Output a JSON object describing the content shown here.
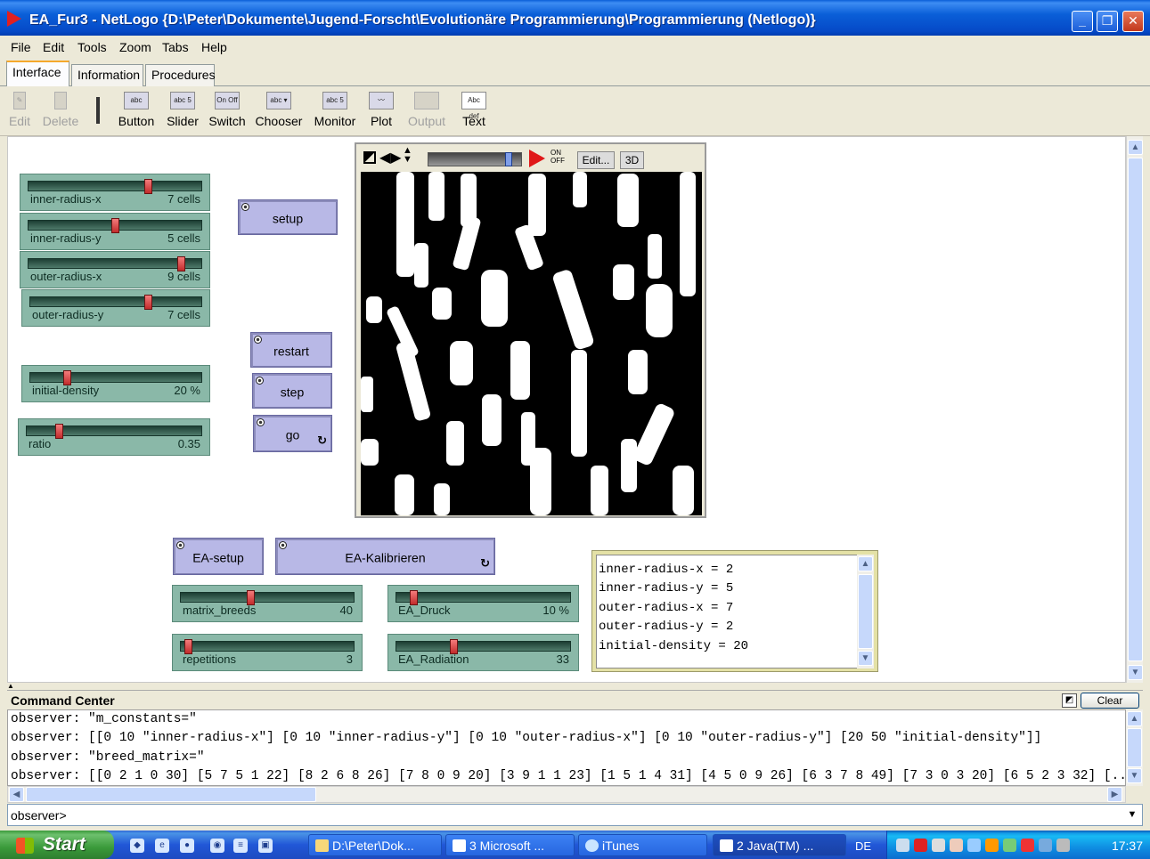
{
  "window": {
    "title": "EA_Fur3 - NetLogo {D:\\Peter\\Dokumente\\Jugend-Forscht\\Evolutionäre Programmierung\\Programmierung (Netlogo)}",
    "min_label": "_",
    "max_label": "❐",
    "close_label": "✕"
  },
  "menu": [
    "File",
    "Edit",
    "Tools",
    "Zoom",
    "Tabs",
    "Help"
  ],
  "tabs": [
    "Interface",
    "Information",
    "Procedures"
  ],
  "toolbar": {
    "tools": [
      "Edit",
      "Delete",
      "Button",
      "Slider",
      "Switch",
      "Chooser",
      "Monitor",
      "Plot",
      "Output",
      "Text"
    ],
    "disabled": [
      "Edit",
      "Delete",
      "Output"
    ]
  },
  "sliders": [
    {
      "id": "inner-radius-x",
      "label": "inner-radius-x",
      "value": "7 cells",
      "fraction": 0.7
    },
    {
      "id": "inner-radius-y",
      "label": "inner-radius-y",
      "value": "5 cells",
      "fraction": 0.5
    },
    {
      "id": "outer-radius-x",
      "label": "outer-radius-x",
      "value": "9 cells",
      "fraction": 0.9
    },
    {
      "id": "outer-radius-y",
      "label": "outer-radius-y",
      "value": "7 cells",
      "fraction": 0.7
    },
    {
      "id": "initial-density",
      "label": "initial-density",
      "value": "20 %",
      "fraction": 0.2
    },
    {
      "id": "ratio",
      "label": "ratio",
      "value": "0.35",
      "fraction": 0.17
    },
    {
      "id": "matrix-breeds",
      "label": "matrix_breeds",
      "value": "40",
      "fraction": 0.4
    },
    {
      "id": "ea-druck",
      "label": "EA_Druck",
      "value": "10 %",
      "fraction": 0.08
    },
    {
      "id": "repetitions",
      "label": "repetitions",
      "value": "3",
      "fraction": 0.02
    },
    {
      "id": "ea-radiation",
      "label": "EA_Radiation",
      "value": "33",
      "fraction": 0.32
    }
  ],
  "buttons": [
    {
      "id": "setup",
      "label": "setup",
      "forever": false
    },
    {
      "id": "restart",
      "label": "restart",
      "forever": false
    },
    {
      "id": "step",
      "label": "step",
      "forever": false
    },
    {
      "id": "go",
      "label": "go",
      "forever": true
    },
    {
      "id": "ea-setup",
      "label": "EA-setup",
      "forever": false
    },
    {
      "id": "ea-kalibrieren",
      "label": "EA-Kalibrieren",
      "forever": true
    }
  ],
  "view": {
    "edit_label": "Edit...",
    "three_d_label": "3D",
    "on_off_label": "ON OFF",
    "speed_fraction": 0.9
  },
  "output_area": {
    "lines": [
      "inner-radius-x = 2",
      "inner-radius-y = 5",
      "outer-radius-x = 7",
      "outer-radius-y = 2",
      "initial-density = 20"
    ]
  },
  "command_center": {
    "title": "Command Center",
    "clear_label": "Clear",
    "log": [
      "observer: \"m_constants=\"",
      "observer: [[0 10 \"inner-radius-x\"] [0 10 \"inner-radius-y\"] [0 10 \"outer-radius-x\"] [0 10 \"outer-radius-y\"] [20 50 \"initial-density\"]]",
      "observer: \"breed_matrix=\"",
      "observer: [[0 2 1 0 30] [5 7 5 1 22] [8 2 6 8 26] [7 8 0 9 20] [3 9 1 1 23] [1 5 1 4 31] [4 5 0 9 26] [6 3 7 8 49] [7 3 0 3 20] [6 5 2 3 32] [..."
    ],
    "prompt": "observer>",
    "input_value": ""
  },
  "taskbar": {
    "start_label": "Start",
    "tasks": [
      {
        "label": "D:\\Peter\\Dok...",
        "active": false
      },
      {
        "label": "3 Microsoft ...",
        "active": false
      },
      {
        "label": "iTunes",
        "active": false
      },
      {
        "label": "2 Java(TM) ...",
        "active": true
      }
    ],
    "language": "DE",
    "clock": "17:37"
  }
}
